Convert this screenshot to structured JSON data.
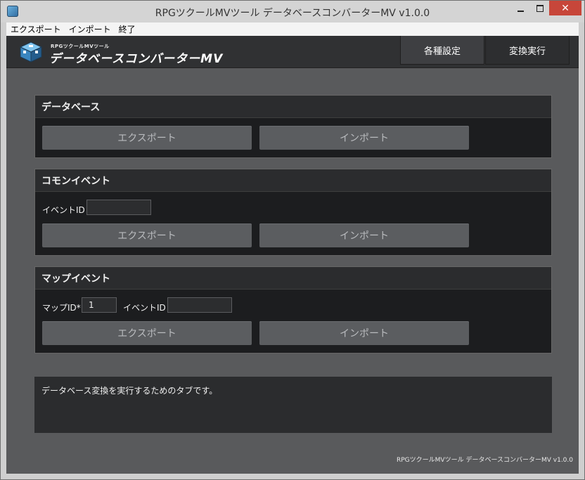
{
  "window": {
    "title": "RPGツクールMVツール データベースコンバーターMV v1.0.0",
    "close_glyph": "✕"
  },
  "menu": {
    "items": [
      "エクスポート",
      "インポート",
      "終了"
    ]
  },
  "header": {
    "logo_small": "RPGツクールMVツール",
    "logo_main": "データベースコンバーターMV",
    "tabs": [
      "各種設定",
      "変換実行"
    ]
  },
  "sections": {
    "database": {
      "title": "データベース",
      "export_label": "エクスポート",
      "import_label": "インポート"
    },
    "common_event": {
      "title": "コモンイベント",
      "event_id_label": "イベントID",
      "event_id_value": "",
      "export_label": "エクスポート",
      "import_label": "インポート"
    },
    "map_event": {
      "title": "マップイベント",
      "map_id_label": "マップID*",
      "map_id_value": "1",
      "event_id_label": "イベントID",
      "event_id_value": "",
      "export_label": "エクスポート",
      "import_label": "インポート"
    }
  },
  "description": "データベース変換を実行するためのタブです。",
  "footer": "RPGツクールMVツール データベースコンバーターMV v1.0.0",
  "colors": {
    "background": "#595a5c",
    "panel": "#1c1d1f",
    "button": "#5b5d60",
    "close_button": "#c7463a"
  }
}
